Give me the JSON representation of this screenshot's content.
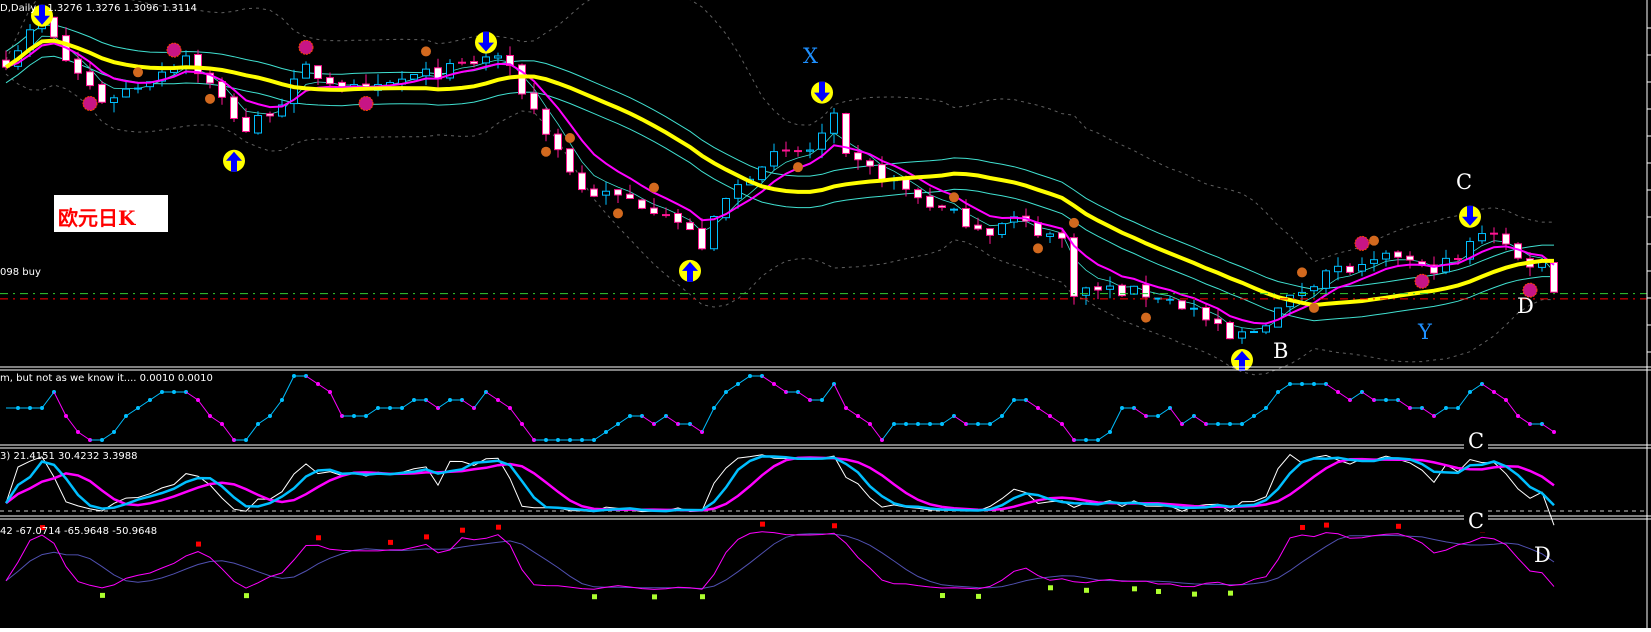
{
  "header": {
    "symbol_info": "D,Daily",
    "ohlc": "1.3276 1.3276 1.3096 1.3114",
    "buy_line_label": "098 buy"
  },
  "note_box": {
    "text": "欧元日K"
  },
  "panels": {
    "osc1_title": "m, but not as we know it....",
    "osc1_values": "0.0010 0.0010",
    "osc2_title": "3)",
    "osc2_values": "21.4151 30.4232 3.3988",
    "osc3_title": "42",
    "osc3_values": "-67.0714 -65.9648 -50.9648"
  },
  "wave_labels": {
    "x": "X",
    "b": "B",
    "c": "C",
    "d": "D",
    "y": "Y",
    "c_panel2": "C",
    "c_panel3": "C",
    "d_panel4": "D"
  },
  "colors": {
    "bull": "#00bfff",
    "bear": "#ff1493",
    "bear_fill": "#ffffff",
    "ma_slow": "#ffff00",
    "ma_fast": "#ff00ff",
    "band": "#40e0d0",
    "envelope": "#606060",
    "buy_line": "#32cd32",
    "sell_line": "#ff0000"
  },
  "chart_data": {
    "type": "candlestick",
    "title": "EURUSD, Daily",
    "bars": 130,
    "ylim": [
      1.29,
      1.395
    ],
    "anchors_bar_index": [
      0,
      3,
      5,
      8,
      11,
      15,
      18,
      20,
      23,
      25,
      30,
      33,
      37,
      41,
      43,
      46,
      48,
      52,
      55,
      58,
      60,
      63,
      67,
      69,
      70,
      73,
      75,
      78,
      82,
      84,
      88,
      89,
      92,
      96,
      99,
      102,
      104,
      107,
      110,
      113,
      116,
      118,
      121,
      123,
      124,
      126,
      129
    ],
    "anchors_close": [
      1.3778,
      1.3893,
      1.3778,
      1.3664,
      1.3707,
      1.3793,
      1.3664,
      1.3578,
      1.3664,
      1.375,
      1.3678,
      1.3721,
      1.375,
      1.3793,
      1.3693,
      1.3521,
      1.3406,
      1.3378,
      1.3349,
      1.3249,
      1.3378,
      1.3492,
      1.3521,
      1.3607,
      1.3492,
      1.3449,
      1.3406,
      1.3349,
      1.3292,
      1.3321,
      1.3263,
      1.312,
      1.312,
      1.3106,
      1.3063,
      1.2977,
      1.3006,
      1.3092,
      1.3178,
      1.3178,
      1.3221,
      1.3178,
      1.3206,
      1.3292,
      1.3292,
      1.3206,
      1.3192
    ],
    "last_close": 1.3114,
    "buy_line_price": 1.311,
    "sell_line_price": 1.3095,
    "signals": [
      {
        "type": "up",
        "bar": 19,
        "price": 1.349
      },
      {
        "type": "up",
        "bar": 57,
        "price": 1.3175
      },
      {
        "type": "up",
        "bar": 103,
        "price": 1.292
      },
      {
        "type": "down",
        "bar": 3,
        "price": 1.3905
      },
      {
        "type": "down",
        "bar": 40,
        "price": 1.3828
      },
      {
        "type": "down",
        "bar": 68,
        "price": 1.3685
      },
      {
        "type": "down",
        "bar": 122,
        "price": 1.333
      }
    ],
    "wave_points": [
      {
        "label": "X",
        "bar": 67,
        "price": 1.379
      },
      {
        "label": "B",
        "bar": 106,
        "price": 1.2915
      },
      {
        "label": "C",
        "bar": 122,
        "price": 1.3425
      },
      {
        "label": "D",
        "bar": 127,
        "price": 1.3055
      },
      {
        "label": "Y",
        "bar": 118,
        "price": 1.2985
      }
    ]
  }
}
